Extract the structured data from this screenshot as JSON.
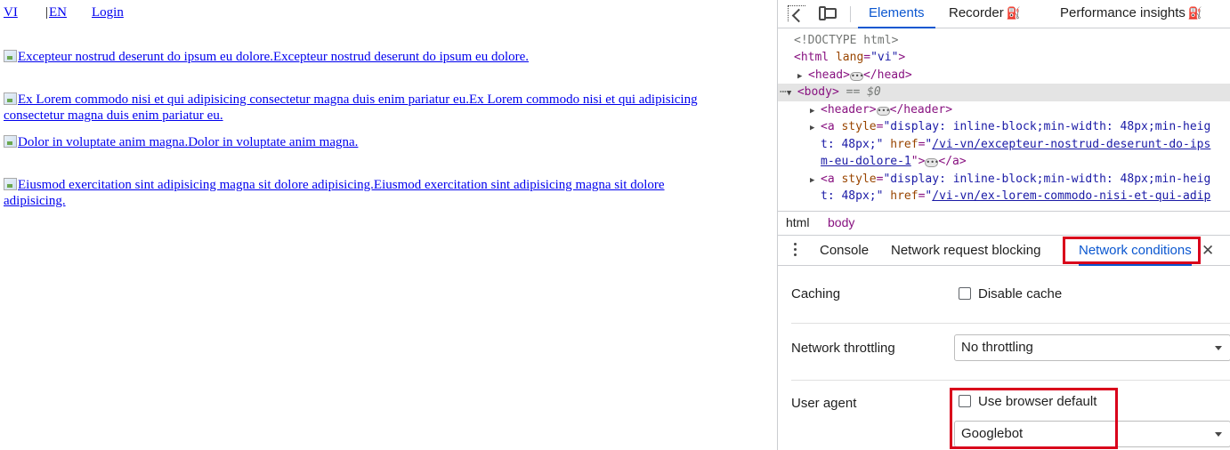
{
  "page": {
    "lang_vi": "VI",
    "lang_sep": "|",
    "lang_en": "EN",
    "login": "Login",
    "posts": [
      "Excepteur nostrud deserunt do ipsum eu dolore.Excepteur nostrud deserunt do ipsum eu dolore.",
      "Ex Lorem commodo nisi et qui adipisicing consectetur magna duis enim pariatur eu.Ex Lorem commodo nisi et qui adipisicing consectetur magna duis enim pariatur eu.",
      "Dolor in voluptate anim magna.Dolor in voluptate anim magna.",
      "Eiusmod exercitation sint adipisicing magna sit dolore adipisicing.Eiusmod exercitation sint adipisicing magna sit dolore adipisicing."
    ]
  },
  "devtools": {
    "icons": [
      "select-element-icon",
      "device-toolbar-icon",
      "flask-icon",
      "more-icon",
      "close-icon"
    ],
    "tabs": [
      "Elements",
      "Recorder",
      "Performance insights"
    ],
    "active_tab": "Elements",
    "dom": {
      "doctype": "<!DOCTYPE html>",
      "html_open_tag": "<html",
      "html_lang_attr": "lang",
      "html_lang_val": "\"vi\"",
      "head": "<head>",
      "head_close": "</head>",
      "body_tag": "<body>",
      "body_eq": " == $0",
      "header": "<header>",
      "header_close": "</header>",
      "a_open": "<a",
      "style_attr": "style",
      "style_val": "\"display: inline-block;min-width: 48px;min-heig",
      "style_val_cont": "t: 48px;\"",
      "href_attr": "href",
      "href1": "/vi-vn/excepteur-nostrud-deserunt-do-ips",
      "href1_cont": "m-eu-dolore-1",
      "a_close": "\">",
      "a_end": "</a>",
      "href2": "/vi-vn/ex-lorem-commodo-nisi-et-qui-adip"
    },
    "breadcrumbs": [
      "html",
      "body"
    ],
    "drawer_tabs": [
      "Console",
      "Network request blocking",
      "Network conditions"
    ],
    "active_drawer_tab": "Network conditions",
    "network_conditions": {
      "caching_label": "Caching",
      "disable_cache_label": "Disable cache",
      "throttling_label": "Network throttling",
      "throttling_value": "No throttling",
      "user_agent_label": "User agent",
      "use_default_label": "Use browser default",
      "user_agent_value": "Googlebot"
    },
    "highlight_color": "#d9001b",
    "accent_color": "#0b57d0"
  }
}
